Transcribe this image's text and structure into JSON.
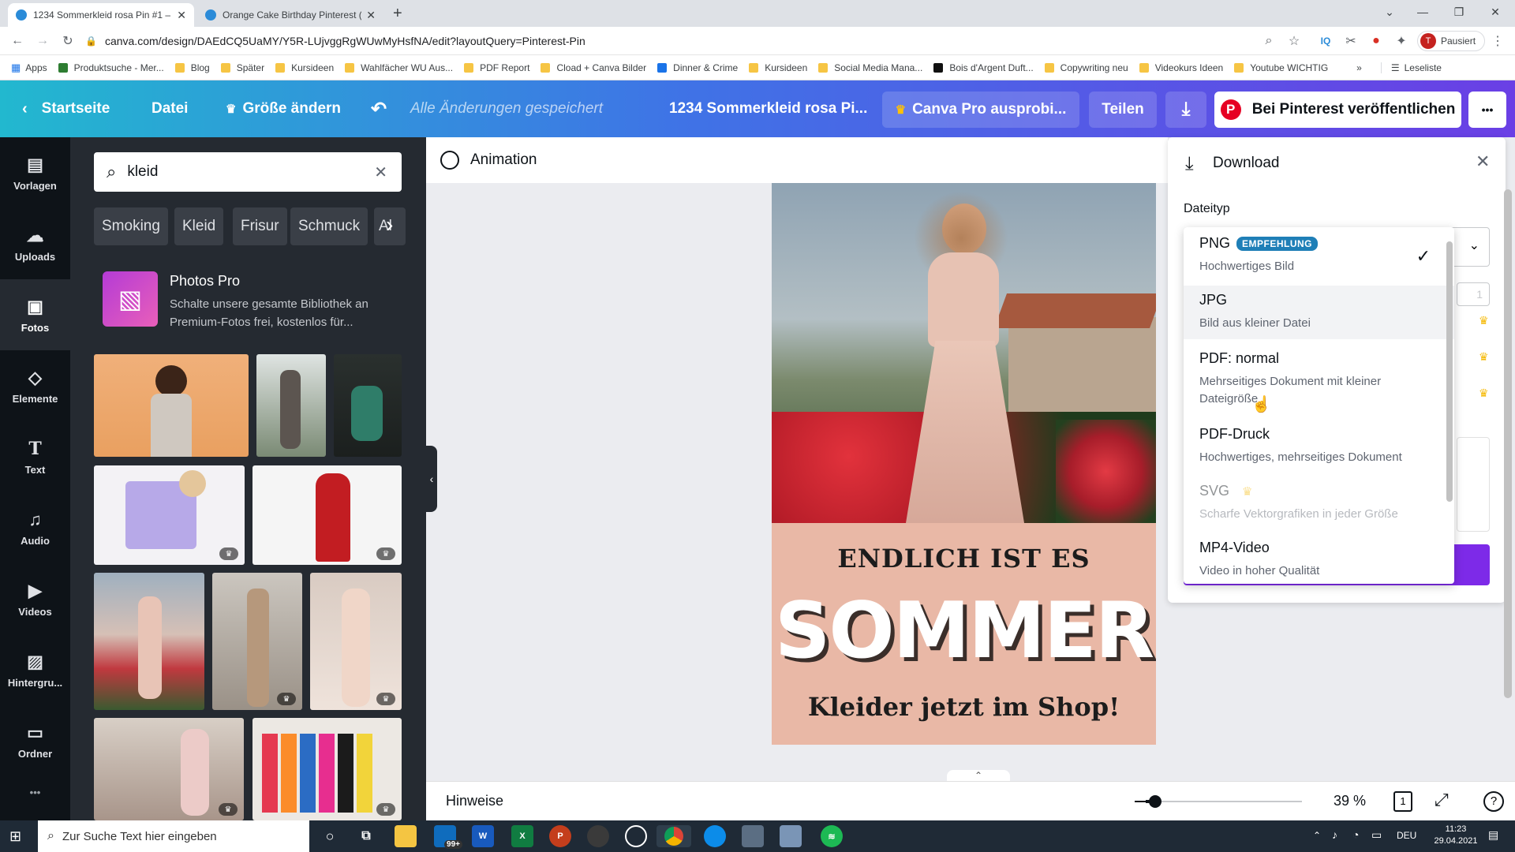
{
  "browser": {
    "tabs": [
      {
        "title": "1234 Sommerkleid rosa Pin #1 – ",
        "active": true
      },
      {
        "title": "Orange Cake Birthday Pinterest (",
        "active": false
      }
    ],
    "new_tab": "+",
    "url": "canva.com/design/DAEdCQ5UaMY/Y5R-LUjvggRgWUwMyHsfNA/edit?layoutQuery=Pinterest-Pin",
    "profile_label": "Pausiert",
    "profile_initial": "T",
    "bookmarks": [
      "Apps",
      "Produktsuche - Mer...",
      "Blog",
      "Später",
      "Kursideen",
      "Wahlfächer WU Aus...",
      "PDF Report",
      "Cload + Canva Bilder",
      "Dinner & Crime",
      "Kursideen",
      "Social Media Mana...",
      "Bois d'Argent Duft...",
      "Copywriting neu",
      "Videokurs Ideen",
      "Youtube WICHTIG"
    ],
    "reading_list": "Leseliste",
    "more": "»"
  },
  "header": {
    "home": "Startseite",
    "file": "Datei",
    "resize": "Größe ändern",
    "saved_status": "Alle Änderungen gespeichert",
    "doc_title": "1234 Sommerkleid rosa Pi...",
    "pro_trial": "Canva Pro ausprobi...",
    "share": "Teilen",
    "publish": "Bei Pinterest veröffentlichen",
    "more": "•••"
  },
  "rail": [
    {
      "label": "Vorlagen",
      "icon": "templates-icon"
    },
    {
      "label": "Uploads",
      "icon": "upload-icon"
    },
    {
      "label": "Fotos",
      "icon": "photos-icon"
    },
    {
      "label": "Elemente",
      "icon": "elements-icon"
    },
    {
      "label": "Text",
      "icon": "text-icon"
    },
    {
      "label": "Audio",
      "icon": "audio-icon"
    },
    {
      "label": "Videos",
      "icon": "videos-icon"
    },
    {
      "label": "Hintergru...",
      "icon": "background-icon"
    },
    {
      "label": "Ordner",
      "icon": "folder-icon"
    }
  ],
  "rail_more": "•••",
  "panel": {
    "search_value": "kleid",
    "chips": [
      "Smoking",
      "Kleid",
      "Frisur",
      "Schmuck",
      "Al"
    ],
    "promo_title": "Photos Pro",
    "promo_text": "Schalte unsere gesamte Bibliothek an Premium-Fotos frei, kostenlos für..."
  },
  "animation_label": "Animation",
  "design": {
    "line1": "ENDLICH IST ES",
    "line2": "SOMMER",
    "line3": "Kleider jetzt im Shop!"
  },
  "bottom": {
    "notes": "Hinweise",
    "zoom": "39 %",
    "page_number": "1",
    "zoom_level": 0.06
  },
  "download": {
    "title": "Download",
    "filetype_label": "Dateityp",
    "options": [
      {
        "name": "PNG",
        "badge": "EMPFEHLUNG",
        "desc": "Hochwertiges Bild",
        "selected": true,
        "disabled": false,
        "pro": false
      },
      {
        "name": "JPG",
        "badge": "",
        "desc": "Bild aus kleiner Datei",
        "selected": false,
        "disabled": false,
        "pro": false
      },
      {
        "name": "PDF: normal",
        "badge": "",
        "desc": "Mehrseitiges Dokument mit kleiner Dateigröße",
        "selected": false,
        "disabled": false,
        "pro": false
      },
      {
        "name": "PDF-Druck",
        "badge": "",
        "desc": "Hochwertiges, mehrseitiges Dokument",
        "selected": false,
        "disabled": false,
        "pro": false
      },
      {
        "name": "SVG",
        "badge": "",
        "desc": "Scharfe Vektorgrafiken in jeder Größe",
        "selected": false,
        "disabled": true,
        "pro": true
      },
      {
        "name": "MP4-Video",
        "badge": "",
        "desc": "Video in hoher Qualität",
        "selected": false,
        "disabled": false,
        "pro": false
      }
    ],
    "peek_value": "1"
  },
  "taskbar": {
    "search_placeholder": "Zur Suche Text hier eingeben",
    "mail_badge": "99+",
    "lang": "DEU",
    "time": "11:23",
    "date": "29.04.2021"
  },
  "colors": {
    "accent_purple": "#7d2ae8",
    "canva_cyan": "#22b8cf",
    "badge_blue": "#1f7fb7",
    "design_bg": "#e9b8a6"
  }
}
